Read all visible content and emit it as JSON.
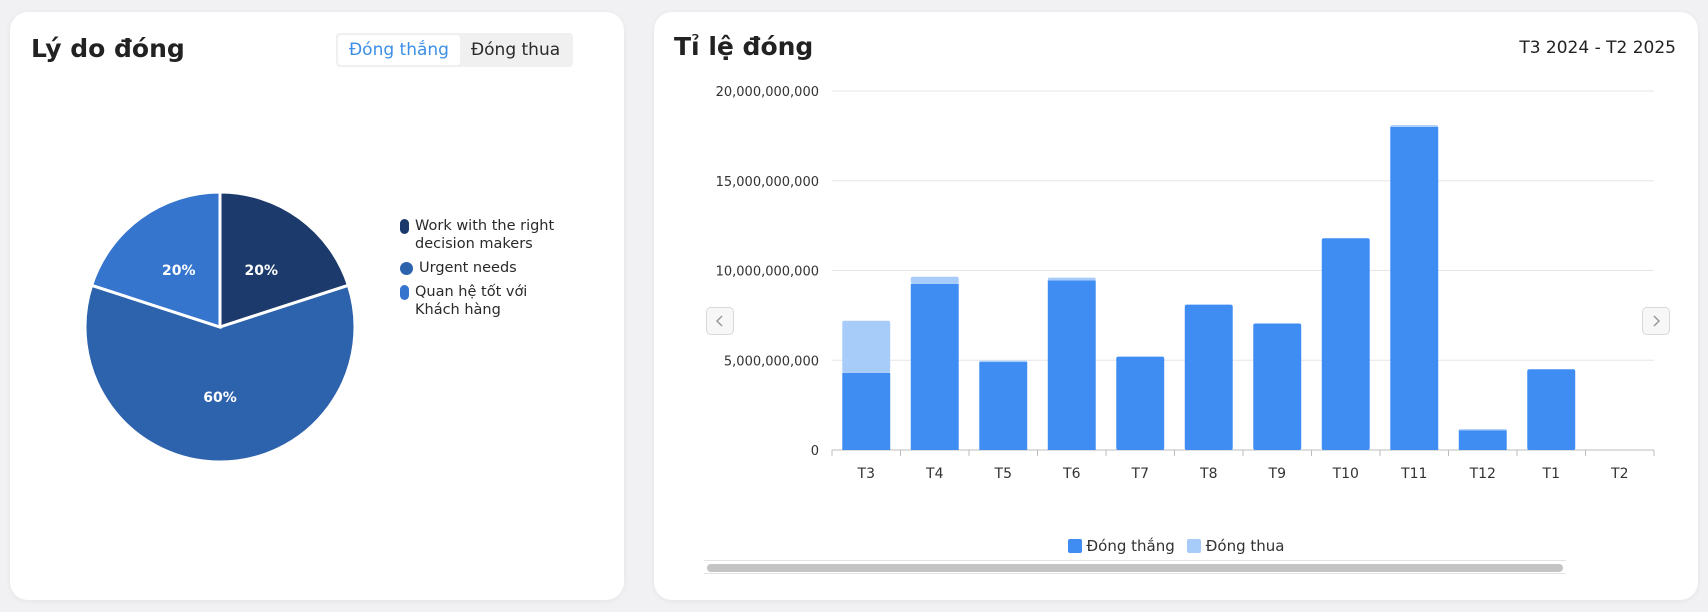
{
  "left_card": {
    "title": "Lý do đóng",
    "toggle": {
      "active": "Đóng thắng",
      "inactive": "Đóng thua"
    }
  },
  "right_card": {
    "title": "Tỉ lệ đóng",
    "period": "T3 2024 - T2 2025"
  },
  "colors": {
    "pie_dark": "#1c3a6b",
    "pie_mid": "#2d62ac",
    "pie_light": "#3575ce",
    "bar_won": "#3f8cf3",
    "bar_lost": "#a8ccfa"
  },
  "chart_data": [
    {
      "type": "pie",
      "slices": [
        {
          "label": "Work with the right decision makers",
          "value": 20,
          "display": "20%",
          "color": "#1c3a6b"
        },
        {
          "label": "Urgent needs",
          "value": 60,
          "display": "60%",
          "color": "#2d62ac"
        },
        {
          "label": "Quan hệ tốt với Khách hàng",
          "value": 20,
          "display": "20%",
          "color": "#3575ce"
        }
      ],
      "legend_position": "right"
    },
    {
      "type": "bar",
      "stacked": true,
      "categories": [
        "T3",
        "T4",
        "T5",
        "T6",
        "T7",
        "T8",
        "T9",
        "T10",
        "T11",
        "T12",
        "T1",
        "T2"
      ],
      "series": [
        {
          "name": "Đóng thắng",
          "color": "#3f8cf3",
          "values": [
            4300000000,
            9250000000,
            4900000000,
            9450000000,
            5200000000,
            8100000000,
            7050000000,
            11800000000,
            18000000000,
            1100000000,
            4500000000,
            0
          ]
        },
        {
          "name": "Đóng thua",
          "color": "#a8ccfa",
          "values": [
            2900000000,
            400000000,
            80000000,
            150000000,
            0,
            0,
            0,
            0,
            100000000,
            60000000,
            0,
            0
          ]
        }
      ],
      "ylim": [
        0,
        20000000000
      ],
      "yticks": [
        "0",
        "5,000,000,000",
        "10,000,000,000",
        "15,000,000,000",
        "20,000,000,000"
      ],
      "ytick_values": [
        0,
        5000000000,
        10000000000,
        15000000000,
        20000000000
      ],
      "grid": true,
      "legend_position": "bottom"
    }
  ]
}
